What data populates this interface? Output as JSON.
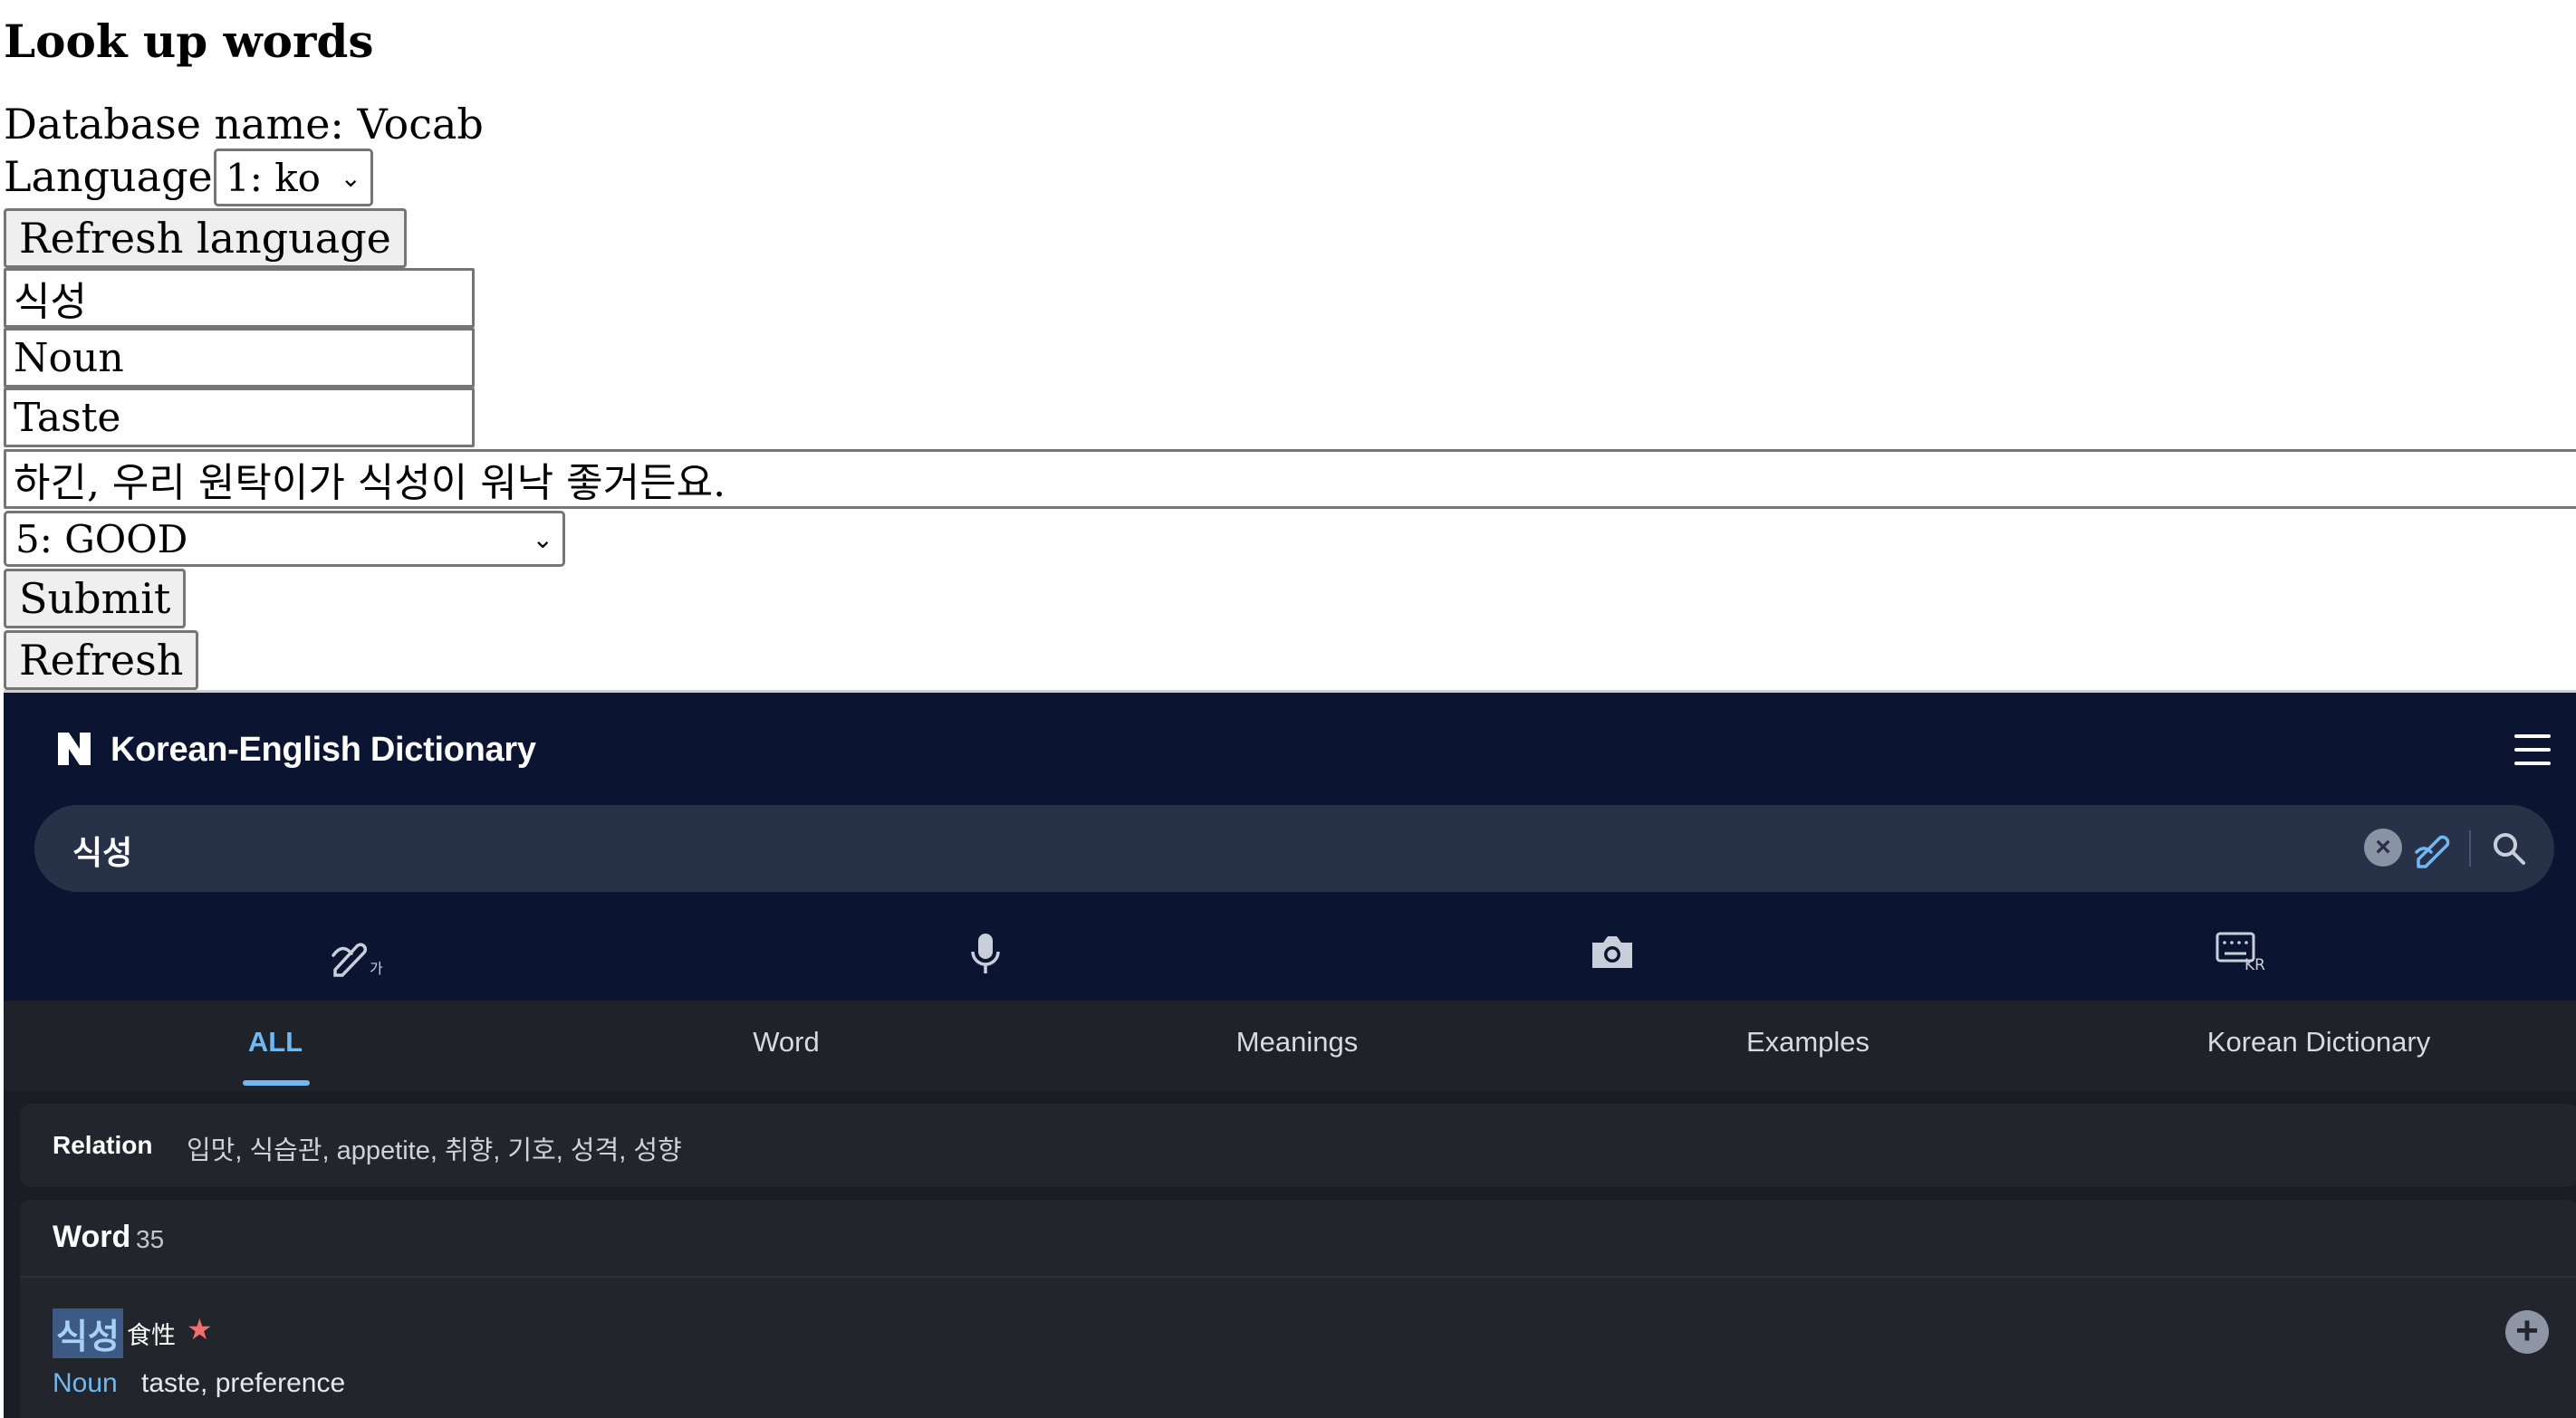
{
  "form": {
    "heading": "Look up words",
    "database_line": "Database name: Vocab",
    "language_label": "Language:",
    "language_selected": "1: ko",
    "refresh_language_label": "Refresh language",
    "word_value": "식성",
    "pos_value": "Noun",
    "meaning_value": "Taste",
    "example_value": "하긴, 우리 원탁이가 식성이 워낙 좋거든요.",
    "rating_selected": "5: GOOD",
    "submit_label": "Submit",
    "refresh_label": "Refresh"
  },
  "dictionary": {
    "logo_letter": "N",
    "title": "Korean-English Dictionary",
    "search_query": "식성",
    "tools": [
      "handwriting-icon",
      "microphone-icon",
      "camera-icon",
      "keyboard-kr-icon"
    ],
    "tabs": [
      "ALL",
      "Word",
      "Meanings",
      "Examples",
      "Korean Dictionary"
    ],
    "active_tab": "ALL",
    "relation": {
      "label": "Relation",
      "items": "입맛,  식습관,  appetite,  취향,  기호,  성격,  성향"
    },
    "word_section": {
      "title": "Word",
      "count": "35",
      "entry": {
        "headword": "식성",
        "hanja": "食性",
        "star": "★",
        "pos": "Noun",
        "definition": "taste, preference"
      }
    },
    "colors": {
      "header_bg": "#0b1430",
      "accent": "#6fb8f1",
      "star": "#ef6e6e"
    }
  }
}
